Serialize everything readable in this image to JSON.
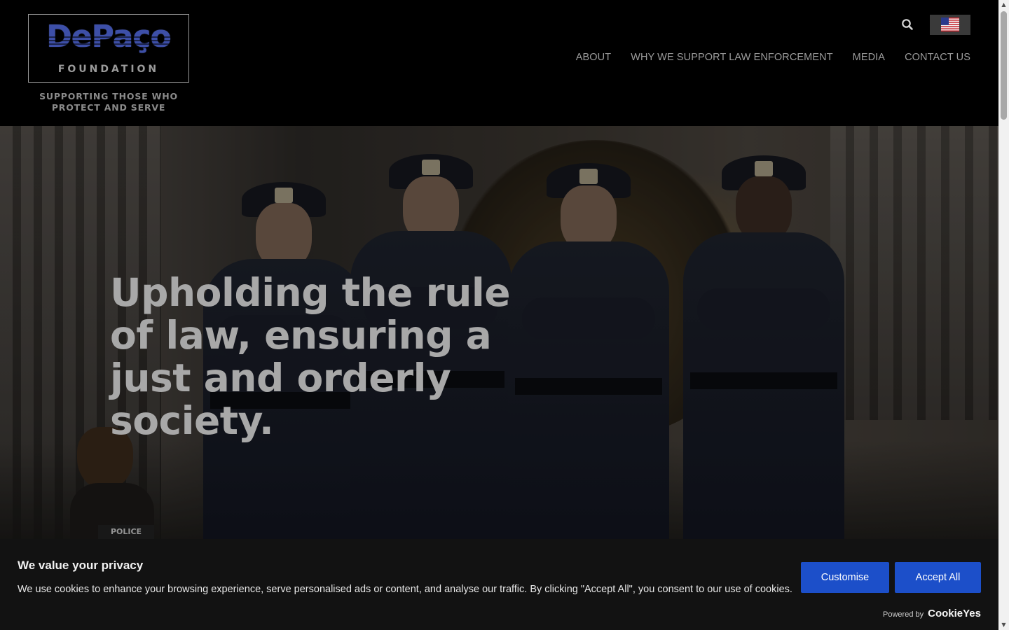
{
  "brand": {
    "name": "DePaço",
    "subtitle": "FOUNDATION",
    "tagline_line1": "SUPPORTING THOSE WHO",
    "tagline_line2": "PROTECT AND SERVE"
  },
  "header": {
    "search_icon": "search-icon",
    "language_flag": "us-flag-icon"
  },
  "nav": {
    "items": [
      {
        "label": "ABOUT"
      },
      {
        "label": "WHY WE SUPPORT LAW ENFORCEMENT"
      },
      {
        "label": "MEDIA"
      },
      {
        "label": "CONTACT US"
      }
    ]
  },
  "hero": {
    "title": "Upholding the rule of law, ensuring a just and orderly society.",
    "dog_vest_text": "POLICE"
  },
  "cookie_banner": {
    "title": "We value your privacy",
    "text": "We use cookies to enhance your browsing experience, serve personalised ads or content, and analyse our traffic. By clicking \"Accept All\", you consent to our use of cookies.",
    "customise_label": "Customise",
    "accept_label": "Accept All",
    "powered_label": "Powered by",
    "powered_brand": "CookieYes"
  },
  "colors": {
    "accent_button": "#1c4fc9",
    "header_bg": "#000000",
    "banner_bg": "#121212"
  }
}
